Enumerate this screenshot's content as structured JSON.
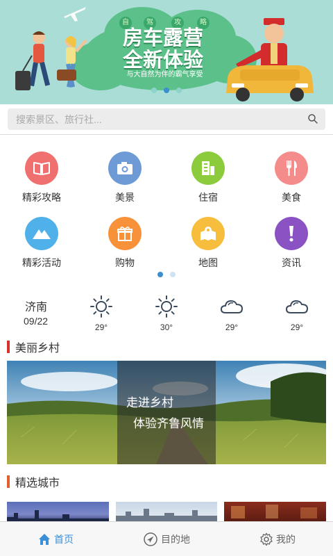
{
  "banner": {
    "tags": [
      "自",
      "驾",
      "攻",
      "略"
    ],
    "title_line1": "房车露营",
    "title_line2": "全新体验",
    "subtitle": "与大自然为伴的霸气享受",
    "page_count": 3,
    "active_page": 2
  },
  "search": {
    "placeholder": "搜索景区、旅行社...",
    "icon": "search-icon"
  },
  "grid": {
    "rows": [
      [
        {
          "label": "精彩攻略",
          "icon": "book-icon",
          "color": "#f07070"
        },
        {
          "label": "美景",
          "icon": "camera-icon",
          "color": "#6e9bd6"
        },
        {
          "label": "住宿",
          "icon": "building-icon",
          "color": "#8ccc3c"
        },
        {
          "label": "美食",
          "icon": "fork-knife-icon",
          "color": "#f58c8c"
        }
      ],
      [
        {
          "label": "精彩活动",
          "icon": "mountain-icon",
          "color": "#4fb0ea"
        },
        {
          "label": "购物",
          "icon": "gift-icon",
          "color": "#f7923a"
        },
        {
          "label": "地图",
          "icon": "map-icon",
          "color": "#f6be3c"
        },
        {
          "label": "资讯",
          "icon": "exclamation-icon",
          "color": "#8b52c4"
        }
      ]
    ],
    "page_count": 2,
    "active_page": 1
  },
  "weather": {
    "city": "济南",
    "date": "09/22",
    "days": [
      {
        "icon": "sun-icon",
        "temp": "29°"
      },
      {
        "icon": "sun-icon",
        "temp": "30°"
      },
      {
        "icon": "cloud-icon",
        "temp": "29°"
      },
      {
        "icon": "cloud-icon",
        "temp": "29°"
      }
    ]
  },
  "sections": {
    "village_title": "美丽乡村",
    "village_caption_line1": "走进乡村",
    "village_caption_line2": "体验齐鲁风情",
    "city_title": "精选城市"
  },
  "tabbar": {
    "tabs": [
      {
        "label": "首页",
        "icon": "home-icon",
        "active": true
      },
      {
        "label": "目的地",
        "icon": "navigation-icon",
        "active": false
      },
      {
        "label": "我的",
        "icon": "gear-icon",
        "active": false
      }
    ]
  },
  "colors": {
    "accent": "#3a8fd6",
    "section_bar": "#d8312d",
    "section_bar_city": "#e0602c"
  }
}
